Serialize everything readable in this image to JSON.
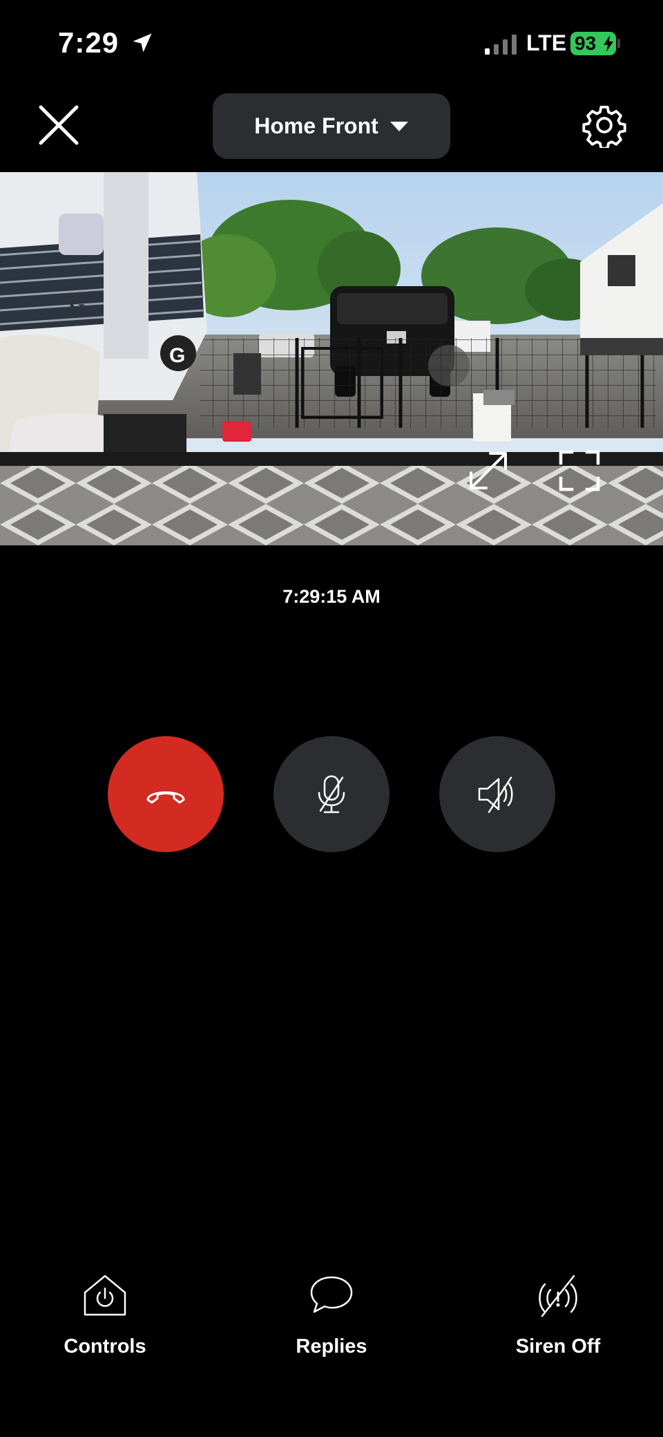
{
  "status_bar": {
    "time": "7:29",
    "network": "LTE",
    "battery": "93"
  },
  "header": {
    "device_name": "Home Front"
  },
  "video": {
    "timestamp": "7:29:15 AM"
  },
  "call_controls": {
    "end_call_color": "#d32a22",
    "button_color": "#2b2d30"
  },
  "actions": {
    "controls_label": "Controls",
    "replies_label": "Replies",
    "siren_label": "Siren Off"
  }
}
